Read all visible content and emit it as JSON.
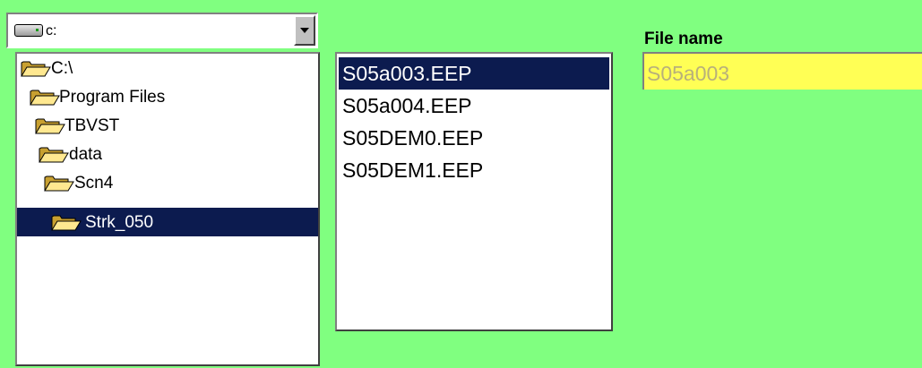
{
  "drive": {
    "label": "c:",
    "icon": "drive-icon"
  },
  "folders": [
    {
      "label": "C:\\",
      "icon": "open-folder-icon",
      "selected": false
    },
    {
      "label": "Program Files",
      "icon": "open-folder-icon",
      "selected": false
    },
    {
      "label": "TBVST",
      "icon": "open-folder-icon",
      "selected": false
    },
    {
      "label": "data",
      "icon": "open-folder-icon",
      "selected": false
    },
    {
      "label": "Scn4",
      "icon": "open-folder-icon",
      "selected": false
    },
    {
      "label": "Strk_050",
      "icon": "open-folder-icon",
      "selected": true
    }
  ],
  "files": [
    {
      "label": "S05a003.EEP",
      "selected": true
    },
    {
      "label": "S05a004.EEP",
      "selected": false
    },
    {
      "label": "S05DEM0.EEP",
      "selected": false
    },
    {
      "label": "S05DEM1.EEP",
      "selected": false
    }
  ],
  "filename": {
    "label": "File name",
    "value": "S05a003"
  },
  "colors": {
    "background": "#80ff80",
    "selection": "#0c1b4f",
    "filename_field": "#ffff55"
  }
}
